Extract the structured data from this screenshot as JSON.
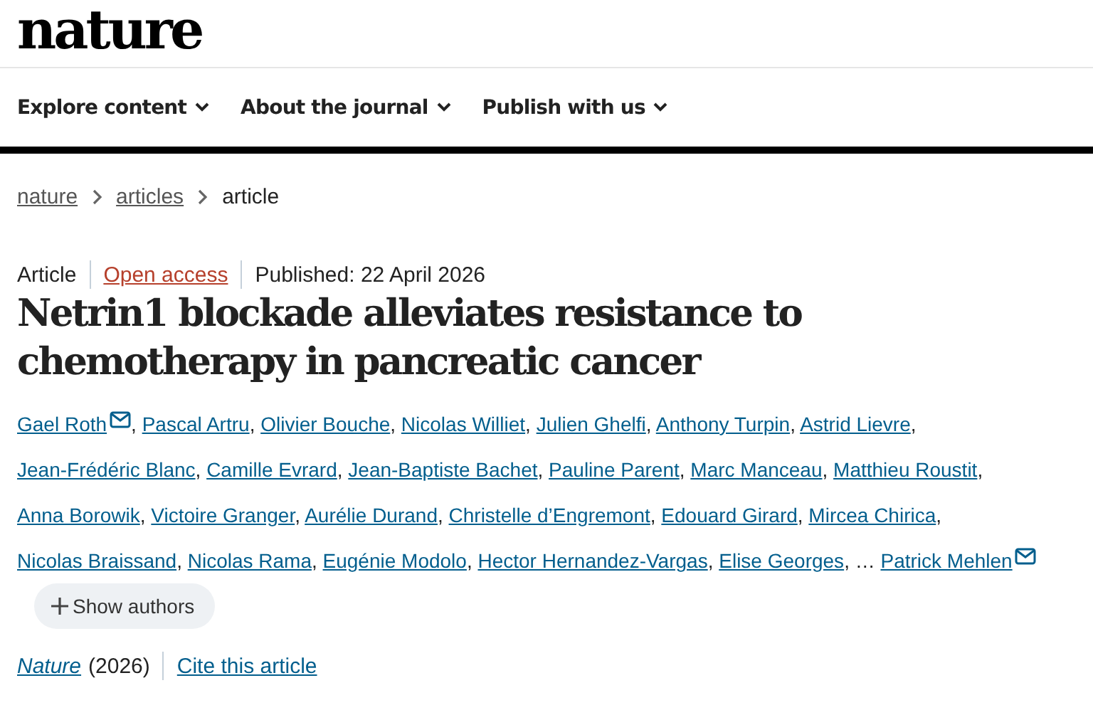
{
  "logo": "nature",
  "nav": [
    {
      "label": "Explore content"
    },
    {
      "label": "About the journal"
    },
    {
      "label": "Publish with us"
    }
  ],
  "breadcrumbs": [
    {
      "label": "nature",
      "link": true
    },
    {
      "label": "articles",
      "link": true
    },
    {
      "label": "article",
      "link": false
    }
  ],
  "meta": {
    "type": "Article",
    "access": "Open access",
    "published": "Published: 22 April 2026"
  },
  "title": "Netrin1 blockade alleviates resistance to chemotherapy in pancreatic cancer",
  "authors": [
    {
      "kind": "author",
      "name": "Gael Roth",
      "corresponding": true,
      "separator": ","
    },
    {
      "kind": "author",
      "name": "Pascal Artru",
      "corresponding": false,
      "separator": ","
    },
    {
      "kind": "author",
      "name": "Olivier Bouche",
      "corresponding": false,
      "separator": ","
    },
    {
      "kind": "author",
      "name": "Nicolas Williet",
      "corresponding": false,
      "separator": ","
    },
    {
      "kind": "author",
      "name": "Julien Ghelfi",
      "corresponding": false,
      "separator": ","
    },
    {
      "kind": "author",
      "name": "Anthony Turpin",
      "corresponding": false,
      "separator": ","
    },
    {
      "kind": "author",
      "name": "Astrid Lievre",
      "corresponding": false,
      "separator": ","
    },
    {
      "kind": "author",
      "name": "Jean-Frédéric Blanc",
      "corresponding": false,
      "separator": ","
    },
    {
      "kind": "author",
      "name": "Camille Evrard",
      "corresponding": false,
      "separator": ","
    },
    {
      "kind": "author",
      "name": "Jean-Baptiste Bachet",
      "corresponding": false,
      "separator": ","
    },
    {
      "kind": "author",
      "name": "Pauline Parent",
      "corresponding": false,
      "separator": ","
    },
    {
      "kind": "author",
      "name": "Marc Manceau",
      "corresponding": false,
      "separator": ","
    },
    {
      "kind": "author",
      "name": "Matthieu Roustit",
      "corresponding": false,
      "separator": ","
    },
    {
      "kind": "author",
      "name": "Anna Borowik",
      "corresponding": false,
      "separator": ","
    },
    {
      "kind": "author",
      "name": "Victoire Granger",
      "corresponding": false,
      "separator": ","
    },
    {
      "kind": "author",
      "name": "Aurélie Durand",
      "corresponding": false,
      "separator": ","
    },
    {
      "kind": "author",
      "name": "Christelle d’Engremont",
      "corresponding": false,
      "separator": ","
    },
    {
      "kind": "author",
      "name": "Edouard Girard",
      "corresponding": false,
      "separator": ","
    },
    {
      "kind": "author",
      "name": "Mircea Chirica",
      "corresponding": false,
      "separator": ","
    },
    {
      "kind": "author",
      "name": "Nicolas Braissand",
      "corresponding": false,
      "separator": ","
    },
    {
      "kind": "author",
      "name": "Nicolas Rama",
      "corresponding": false,
      "separator": ","
    },
    {
      "kind": "author",
      "name": "Eugénie Modolo",
      "corresponding": false,
      "separator": ","
    },
    {
      "kind": "author",
      "name": "Hector Hernandez-Vargas",
      "corresponding": false,
      "separator": ","
    },
    {
      "kind": "author",
      "name": "Elise Georges",
      "corresponding": false,
      "separator": ","
    },
    {
      "kind": "ellipsis",
      "name": "…"
    },
    {
      "kind": "author",
      "name": "Patrick Mehlen",
      "corresponding": true
    }
  ],
  "show_authors": "Show authors",
  "citation": {
    "journal": "Nature",
    "year": "(2026)",
    "cite": "Cite this article"
  }
}
